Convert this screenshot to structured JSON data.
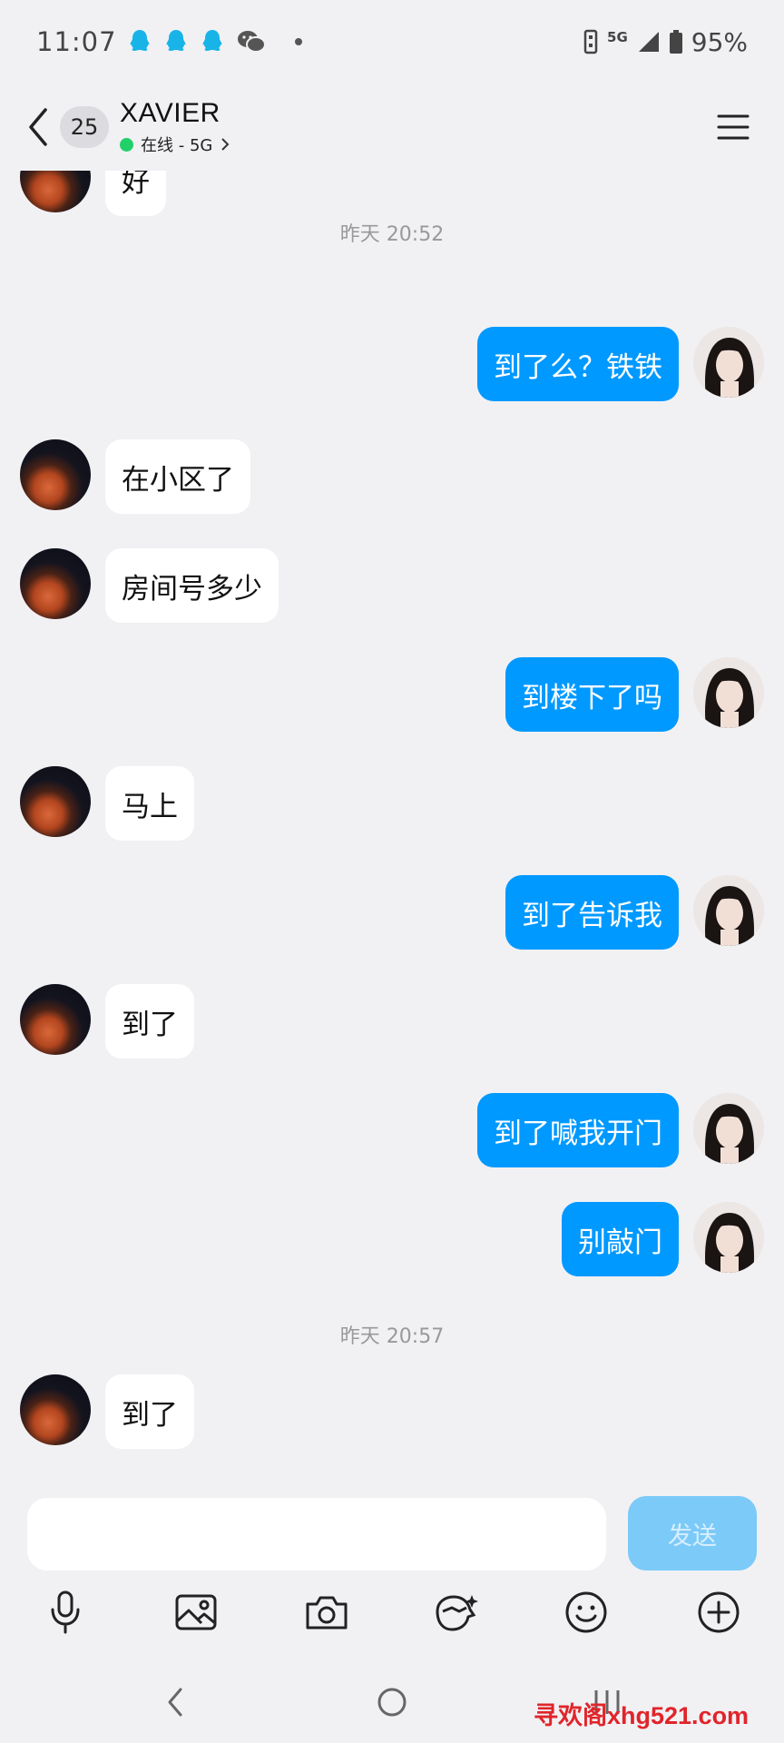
{
  "status_bar": {
    "time": "11:07",
    "network": "5G",
    "battery": "95%"
  },
  "header": {
    "unread_count": "25",
    "contact_name": "XAVIER",
    "status": "在线 - 5G"
  },
  "messages": [
    {
      "side": "left",
      "text": "好"
    },
    {
      "type": "time",
      "text": "昨天 20:52"
    },
    {
      "side": "right",
      "text": "到了么？铁铁"
    },
    {
      "side": "left",
      "text": "在小区了"
    },
    {
      "side": "left",
      "text": "房间号多少"
    },
    {
      "side": "right",
      "text": "到楼下了吗"
    },
    {
      "side": "left",
      "text": "马上"
    },
    {
      "side": "right",
      "text": "到了告诉我"
    },
    {
      "side": "left",
      "text": "到了"
    },
    {
      "side": "right",
      "text": "到了喊我开门"
    },
    {
      "side": "right",
      "text": "别敲门"
    },
    {
      "type": "time",
      "text": "昨天 20:57"
    },
    {
      "side": "left",
      "text": "到了"
    }
  ],
  "input": {
    "value": "",
    "send_label": "发送"
  },
  "toolbar_icons": [
    "microphone-icon",
    "image-icon",
    "camera-icon",
    "red-packet-icon",
    "emoji-icon",
    "plus-icon"
  ],
  "watermark": "寻欢阁xhg521.com",
  "colors": {
    "sent_bubble": "#0099ff",
    "received_bubble": "#ffffff",
    "send_button": "#7ccaf8",
    "online": "#22d06a"
  }
}
